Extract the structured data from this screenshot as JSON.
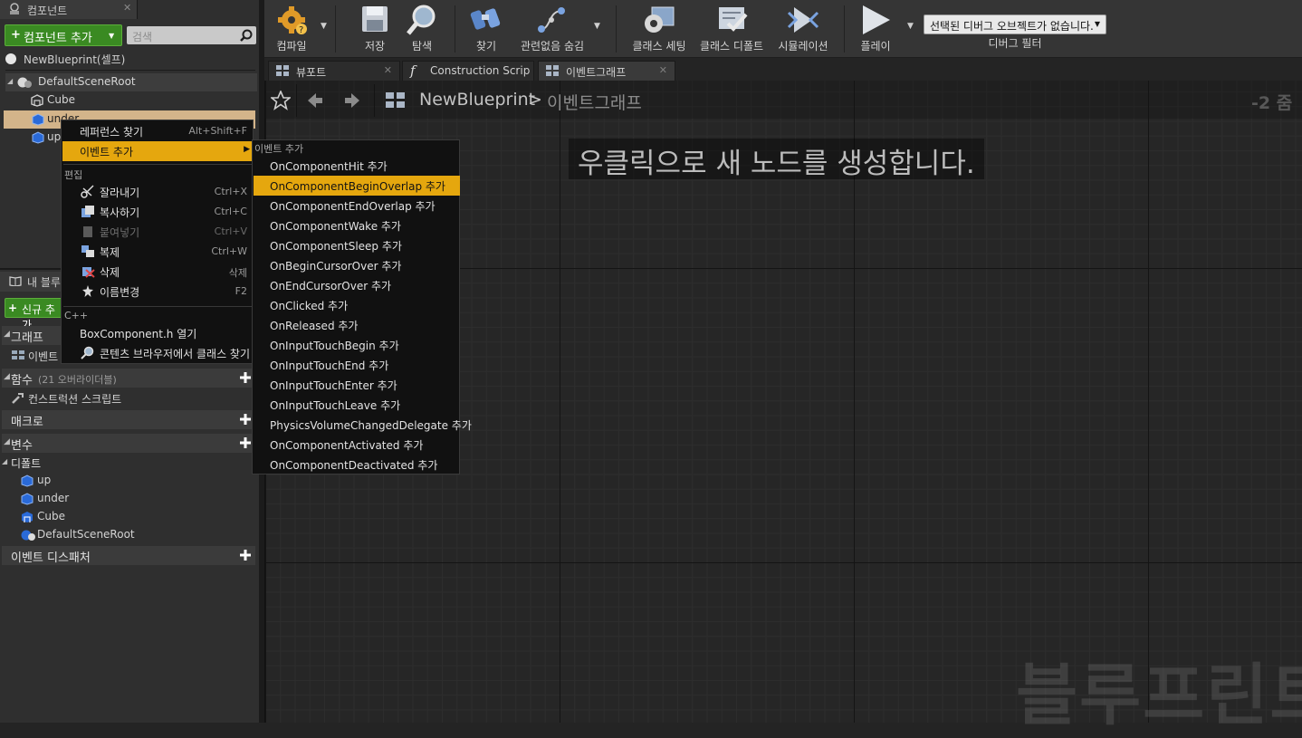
{
  "components_panel": {
    "tab_title": "컴포넌트",
    "add_button": "컴포넌트 추가",
    "search_placeholder": "검색",
    "self_label": "NewBlueprint(셀프)",
    "tree": [
      "DefaultSceneRoot",
      "Cube",
      "under",
      "up"
    ]
  },
  "my_blueprint": {
    "tab_title": "내 블루",
    "new_add_button": "신규 추가",
    "graph_section": "그래프",
    "graph_item": "이벤트",
    "functions_section": "함수",
    "functions_note": "(21 오버라이더블)",
    "construction_script": "컨스트럭션 스크립트",
    "macros_section": "매크로",
    "variables_section": "변수",
    "defaults_section": "디폴트",
    "variables": [
      "up",
      "under",
      "Cube",
      "DefaultSceneRoot"
    ],
    "dispatchers_section": "이벤트 디스패처"
  },
  "toolbar": {
    "compile": "컴파일",
    "save": "저장",
    "browse": "탐색",
    "find": "찾기",
    "hide_unrelated": "관련없음 숨김",
    "class_settings": "클래스 세팅",
    "class_defaults": "클래스 디폴트",
    "simulation": "시뮬레이션",
    "play": "플레이",
    "debug_select": "선택된 디버그 오브젝트가 없습니다.",
    "debug_filter": "디버그 필터"
  },
  "doc_tabs": [
    "뷰포트",
    "Construction Scrip",
    "이벤트그래프"
  ],
  "graph": {
    "breadcrumb_blueprint": "NewBlueprint",
    "breadcrumb_sep": ">",
    "breadcrumb_graph": "이벤트그래프",
    "zoom": "-2 줌",
    "hint": "우클릭으로 새 노드를 생성합니다.",
    "watermark": "블루프린트"
  },
  "context_menu": {
    "find_refs": "레퍼런스 찾기",
    "find_refs_shortcut": "Alt+Shift+F",
    "add_event": "이벤트 추가",
    "edit_header": "편집",
    "cut": "잘라내기",
    "cut_shortcut": "Ctrl+X",
    "copy": "복사하기",
    "copy_shortcut": "Ctrl+C",
    "paste": "붙여넣기",
    "paste_shortcut": "Ctrl+V",
    "duplicate": "복제",
    "duplicate_shortcut": "Ctrl+W",
    "delete": "삭제",
    "delete_shortcut": "삭제",
    "rename": "이름변경",
    "rename_shortcut": "F2",
    "cpp_header": "C++",
    "open_header": "BoxComponent.h 열기",
    "find_in_browser": "콘텐츠 브라우저에서 클래스 찾기"
  },
  "event_submenu": {
    "header": "이벤트 추가",
    "items": [
      "OnComponentHit 추가",
      "OnComponentBeginOverlap 추가",
      "OnComponentEndOverlap 추가",
      "OnComponentWake 추가",
      "OnComponentSleep 추가",
      "OnBeginCursorOver 추가",
      "OnEndCursorOver 추가",
      "OnClicked 추가",
      "OnReleased 추가",
      "OnInputTouchBegin 추가",
      "OnInputTouchEnd 추가",
      "OnInputTouchEnter 추가",
      "OnInputTouchLeave 추가",
      "PhysicsVolumeChangedDelegate 추가",
      "OnComponentActivated 추가",
      "OnComponentDeactivated 추가"
    ],
    "highlighted_index": 1
  },
  "colors": {
    "accent": "#e5a70e",
    "add_green": "#3a8a22",
    "selected_row": "#d3b48a"
  }
}
